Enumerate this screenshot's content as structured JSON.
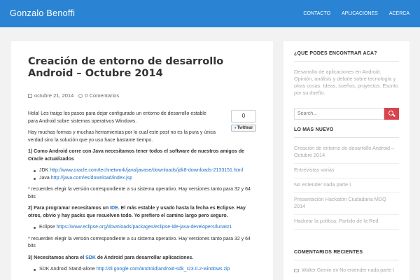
{
  "header": {
    "brand": "Gonzalo Benoffi",
    "nav": [
      "CONTACTO",
      "APLICACIONES",
      "ACERCA"
    ]
  },
  "post": {
    "title": "Creación de entorno de desarrollo Android – Octubre 2014",
    "date": "octubre 21, 2014",
    "comments": "0 Comentarios",
    "tweet_count": "0",
    "tweet_label": "Twittear",
    "intro1": "Hola! Les traigo los pasos para dejar configurado un entorno de desarrollo estable para Android sobre sistemas operativos Windows.",
    "intro2": "Hay muchas formas y muchas herramientas por lo cual este post no es la pura y única verdad sino la solución que yo uso hace bastante tiempo.",
    "step1": "1) Como Android corre con Java necesitamos tener todos el software de nuestros amigos de Oracle actualizados",
    "step1_items": [
      {
        "label": "JDK",
        "url": "http://www.oracle.com/technetwork/java/javase/downloads/jdk8-downloads-2133151.html"
      },
      {
        "label": "Java",
        "url": "http://java.com/es/download/index.jsp"
      }
    ],
    "note1": "* recuerden elegir la versión correspondiente a su sistema operativo. Hay versiones tanto para 32 y 64 bits",
    "step2_before": "2) Para programar necesitamos un ",
    "step2_link": "IDE",
    "step2_after": ". El más estable y usado hasta la fecha es Eclipse. Hay otros, obvio y hay packs que resuelven todo. Yo prefiero el camino largo pero seguro.",
    "step2_items": [
      {
        "label": "Eclipse",
        "url": "https://www.eclipse.org/downloads/packages/eclipse-ide-java-developers/lunasr1"
      }
    ],
    "note2": "* recuerden elegir la versión correspondiente a su sistema operativo. Hay versiones tanto para 32 y 64 bits",
    "step3_before": "3) Necesitamos ahora el ",
    "step3_link": "SDK",
    "step3_after": " de Android para desarrollar aplicaciones.",
    "step3_items": [
      {
        "label": "SDK Android Stand-alone",
        "url": "http://dl.google.com/android/android-sdk_r23.0.2-windows.zip"
      }
    ]
  },
  "sidebar": {
    "about_title": "¿QUE PODES ENCONTRAR ACA?",
    "about_text": "Desarrollo de aplicaciones en Android. Opinión, análisis y debate sobre tecnología y otras cosas. Ideas, sueños, proyectos. Escrito por su dueño.",
    "search_placeholder": "Search...",
    "recent_title": "LO MAS NUEVO",
    "recent_posts": [
      "Creación de entorno de desarrollo Android – Octubre 2014",
      "Entrevistas varias",
      "No entender nada parte I",
      "Presentación Hackatón Ciudadana MDQ 2014",
      "Hackear la política: Partido de la Red"
    ],
    "comments_title": "COMENTARIOS RECIENTES",
    "comment": "Walter Gemin en No entender nada parte I"
  }
}
